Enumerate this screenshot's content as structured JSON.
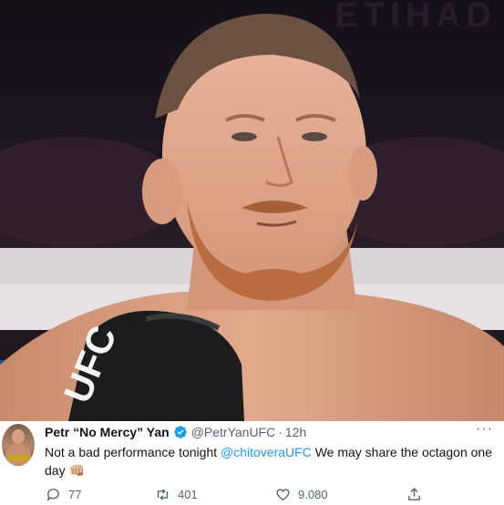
{
  "photo": {
    "watermark": "ETIHAD",
    "glove_text": "UFC",
    "flag_colors": [
      "#ffffff",
      "#1a4fa3",
      "#d52b1e"
    ]
  },
  "tweet": {
    "author_name": "Petr “No Mercy” Yan",
    "handle": "@PetrYanUFC",
    "separator": "·",
    "time": "12h",
    "more_icon": "···",
    "text_before": "Not a bad performance tonight ",
    "mention": "@chitoveraUFC",
    "text_after": " We may share the octagon one day ",
    "emoji": "👊🏼",
    "verified_icon": "verified-badge-icon",
    "accent_color": "#1d9bf0"
  },
  "actions": {
    "replies": "77",
    "retweets": "401",
    "likes": "9.080",
    "share_icon": "share-icon"
  }
}
